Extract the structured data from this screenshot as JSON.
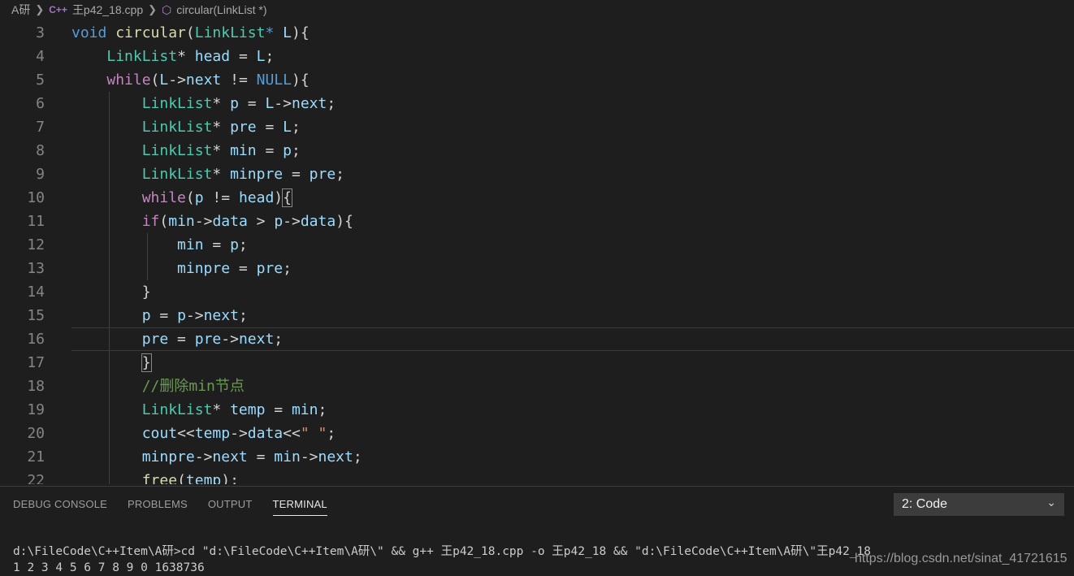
{
  "breadcrumb": {
    "folder": "A研",
    "file": "王p42_18.cpp",
    "symbol": "circular(LinkList *)"
  },
  "editor": {
    "line_numbers": [
      "3",
      "4",
      "5",
      "6",
      "7",
      "8",
      "9",
      "10",
      "11",
      "12",
      "13",
      "14",
      "15",
      "16",
      "17",
      "18",
      "19",
      "20",
      "21",
      "22"
    ],
    "lines": [
      "void circular(LinkList* L){",
      "    LinkList* head = L;",
      "    while(L->next != NULL){",
      "        LinkList* p = L->next;",
      "        LinkList* pre = L;",
      "        LinkList* min = p;",
      "        LinkList* minpre = pre;",
      "        while(p != head){",
      "        if(min->data > p->data){",
      "            min = p;",
      "            minpre = pre;",
      "        }",
      "        p = p->next;",
      "        pre = pre->next;",
      "        }",
      "        //删除min节点",
      "        LinkList* temp = min;",
      "        cout<<temp->data<<\" \";",
      "        minpre->next = min->next;",
      "        free(temp);"
    ]
  },
  "panel": {
    "tabs": [
      "DEBUG CONSOLE",
      "PROBLEMS",
      "OUTPUT",
      "TERMINAL"
    ],
    "active_tab": "TERMINAL",
    "terminal_select": "2: Code",
    "terminal_lines": [
      "d:\\FileCode\\C++Item\\A研>cd \"d:\\FileCode\\C++Item\\A研\\\" && g++ 王p42_18.cpp -o 王p42_18 && \"d:\\FileCode\\C++Item\\A研\\\"王p42_18",
      "1 2 3 4 5 6 7 8 9 0 1638736"
    ],
    "watermark": "https://blog.csdn.net/sinat_41721615"
  },
  "icons": {
    "breadcrumb_sep": "chevron-right-icon",
    "file": "cpp-file-icon",
    "symbol": "cube-icon",
    "select": "chevron-down-icon"
  },
  "colors": {
    "background": "#1e1e1e",
    "keyword": "#c586c0",
    "type": "#4ec9b0",
    "function": "#dcdcaa",
    "variable": "#9cdcfe",
    "constant": "#569cd6",
    "string": "#ce9178",
    "comment": "#6a9955",
    "line_number": "#858585"
  }
}
